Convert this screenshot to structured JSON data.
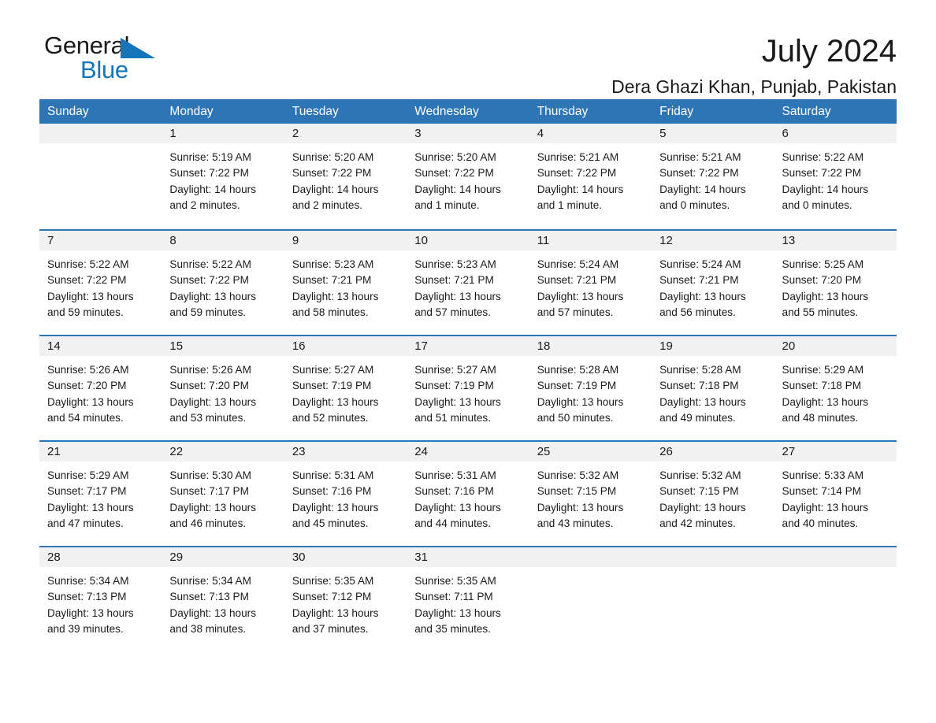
{
  "logo": {
    "word_one": "General",
    "word_two": "Blue",
    "accent_color": "#1475ba"
  },
  "header": {
    "title": "July 2024",
    "location": "Dera Ghazi Khan, Punjab, Pakistan"
  },
  "theme": {
    "header_blue": "#2e75b6",
    "day_band_gray": "#f1f1f1",
    "text_color": "#1a1a1a"
  },
  "weekdays": [
    "Sunday",
    "Monday",
    "Tuesday",
    "Wednesday",
    "Thursday",
    "Friday",
    "Saturday"
  ],
  "weeks": [
    [
      {
        "day": "",
        "empty": true,
        "sunrise": "",
        "sunset": "",
        "daylight_line1": "",
        "daylight_line2": ""
      },
      {
        "day": "1",
        "sunrise": "Sunrise: 5:19 AM",
        "sunset": "Sunset: 7:22 PM",
        "daylight_line1": "Daylight: 14 hours",
        "daylight_line2": "and 2 minutes."
      },
      {
        "day": "2",
        "sunrise": "Sunrise: 5:20 AM",
        "sunset": "Sunset: 7:22 PM",
        "daylight_line1": "Daylight: 14 hours",
        "daylight_line2": "and 2 minutes."
      },
      {
        "day": "3",
        "sunrise": "Sunrise: 5:20 AM",
        "sunset": "Sunset: 7:22 PM",
        "daylight_line1": "Daylight: 14 hours",
        "daylight_line2": "and 1 minute."
      },
      {
        "day": "4",
        "sunrise": "Sunrise: 5:21 AM",
        "sunset": "Sunset: 7:22 PM",
        "daylight_line1": "Daylight: 14 hours",
        "daylight_line2": "and 1 minute."
      },
      {
        "day": "5",
        "sunrise": "Sunrise: 5:21 AM",
        "sunset": "Sunset: 7:22 PM",
        "daylight_line1": "Daylight: 14 hours",
        "daylight_line2": "and 0 minutes."
      },
      {
        "day": "6",
        "sunrise": "Sunrise: 5:22 AM",
        "sunset": "Sunset: 7:22 PM",
        "daylight_line1": "Daylight: 14 hours",
        "daylight_line2": "and 0 minutes."
      }
    ],
    [
      {
        "day": "7",
        "sunrise": "Sunrise: 5:22 AM",
        "sunset": "Sunset: 7:22 PM",
        "daylight_line1": "Daylight: 13 hours",
        "daylight_line2": "and 59 minutes."
      },
      {
        "day": "8",
        "sunrise": "Sunrise: 5:22 AM",
        "sunset": "Sunset: 7:22 PM",
        "daylight_line1": "Daylight: 13 hours",
        "daylight_line2": "and 59 minutes."
      },
      {
        "day": "9",
        "sunrise": "Sunrise: 5:23 AM",
        "sunset": "Sunset: 7:21 PM",
        "daylight_line1": "Daylight: 13 hours",
        "daylight_line2": "and 58 minutes."
      },
      {
        "day": "10",
        "sunrise": "Sunrise: 5:23 AM",
        "sunset": "Sunset: 7:21 PM",
        "daylight_line1": "Daylight: 13 hours",
        "daylight_line2": "and 57 minutes."
      },
      {
        "day": "11",
        "sunrise": "Sunrise: 5:24 AM",
        "sunset": "Sunset: 7:21 PM",
        "daylight_line1": "Daylight: 13 hours",
        "daylight_line2": "and 57 minutes."
      },
      {
        "day": "12",
        "sunrise": "Sunrise: 5:24 AM",
        "sunset": "Sunset: 7:21 PM",
        "daylight_line1": "Daylight: 13 hours",
        "daylight_line2": "and 56 minutes."
      },
      {
        "day": "13",
        "sunrise": "Sunrise: 5:25 AM",
        "sunset": "Sunset: 7:20 PM",
        "daylight_line1": "Daylight: 13 hours",
        "daylight_line2": "and 55 minutes."
      }
    ],
    [
      {
        "day": "14",
        "sunrise": "Sunrise: 5:26 AM",
        "sunset": "Sunset: 7:20 PM",
        "daylight_line1": "Daylight: 13 hours",
        "daylight_line2": "and 54 minutes."
      },
      {
        "day": "15",
        "sunrise": "Sunrise: 5:26 AM",
        "sunset": "Sunset: 7:20 PM",
        "daylight_line1": "Daylight: 13 hours",
        "daylight_line2": "and 53 minutes."
      },
      {
        "day": "16",
        "sunrise": "Sunrise: 5:27 AM",
        "sunset": "Sunset: 7:19 PM",
        "daylight_line1": "Daylight: 13 hours",
        "daylight_line2": "and 52 minutes."
      },
      {
        "day": "17",
        "sunrise": "Sunrise: 5:27 AM",
        "sunset": "Sunset: 7:19 PM",
        "daylight_line1": "Daylight: 13 hours",
        "daylight_line2": "and 51 minutes."
      },
      {
        "day": "18",
        "sunrise": "Sunrise: 5:28 AM",
        "sunset": "Sunset: 7:19 PM",
        "daylight_line1": "Daylight: 13 hours",
        "daylight_line2": "and 50 minutes."
      },
      {
        "day": "19",
        "sunrise": "Sunrise: 5:28 AM",
        "sunset": "Sunset: 7:18 PM",
        "daylight_line1": "Daylight: 13 hours",
        "daylight_line2": "and 49 minutes."
      },
      {
        "day": "20",
        "sunrise": "Sunrise: 5:29 AM",
        "sunset": "Sunset: 7:18 PM",
        "daylight_line1": "Daylight: 13 hours",
        "daylight_line2": "and 48 minutes."
      }
    ],
    [
      {
        "day": "21",
        "sunrise": "Sunrise: 5:29 AM",
        "sunset": "Sunset: 7:17 PM",
        "daylight_line1": "Daylight: 13 hours",
        "daylight_line2": "and 47 minutes."
      },
      {
        "day": "22",
        "sunrise": "Sunrise: 5:30 AM",
        "sunset": "Sunset: 7:17 PM",
        "daylight_line1": "Daylight: 13 hours",
        "daylight_line2": "and 46 minutes."
      },
      {
        "day": "23",
        "sunrise": "Sunrise: 5:31 AM",
        "sunset": "Sunset: 7:16 PM",
        "daylight_line1": "Daylight: 13 hours",
        "daylight_line2": "and 45 minutes."
      },
      {
        "day": "24",
        "sunrise": "Sunrise: 5:31 AM",
        "sunset": "Sunset: 7:16 PM",
        "daylight_line1": "Daylight: 13 hours",
        "daylight_line2": "and 44 minutes."
      },
      {
        "day": "25",
        "sunrise": "Sunrise: 5:32 AM",
        "sunset": "Sunset: 7:15 PM",
        "daylight_line1": "Daylight: 13 hours",
        "daylight_line2": "and 43 minutes."
      },
      {
        "day": "26",
        "sunrise": "Sunrise: 5:32 AM",
        "sunset": "Sunset: 7:15 PM",
        "daylight_line1": "Daylight: 13 hours",
        "daylight_line2": "and 42 minutes."
      },
      {
        "day": "27",
        "sunrise": "Sunrise: 5:33 AM",
        "sunset": "Sunset: 7:14 PM",
        "daylight_line1": "Daylight: 13 hours",
        "daylight_line2": "and 40 minutes."
      }
    ],
    [
      {
        "day": "28",
        "sunrise": "Sunrise: 5:34 AM",
        "sunset": "Sunset: 7:13 PM",
        "daylight_line1": "Daylight: 13 hours",
        "daylight_line2": "and 39 minutes."
      },
      {
        "day": "29",
        "sunrise": "Sunrise: 5:34 AM",
        "sunset": "Sunset: 7:13 PM",
        "daylight_line1": "Daylight: 13 hours",
        "daylight_line2": "and 38 minutes."
      },
      {
        "day": "30",
        "sunrise": "Sunrise: 5:35 AM",
        "sunset": "Sunset: 7:12 PM",
        "daylight_line1": "Daylight: 13 hours",
        "daylight_line2": "and 37 minutes."
      },
      {
        "day": "31",
        "sunrise": "Sunrise: 5:35 AM",
        "sunset": "Sunset: 7:11 PM",
        "daylight_line1": "Daylight: 13 hours",
        "daylight_line2": "and 35 minutes."
      },
      {
        "day": "",
        "empty": true,
        "sunrise": "",
        "sunset": "",
        "daylight_line1": "",
        "daylight_line2": ""
      },
      {
        "day": "",
        "empty": true,
        "sunrise": "",
        "sunset": "",
        "daylight_line1": "",
        "daylight_line2": ""
      },
      {
        "day": "",
        "empty": true,
        "sunrise": "",
        "sunset": "",
        "daylight_line1": "",
        "daylight_line2": ""
      }
    ]
  ]
}
